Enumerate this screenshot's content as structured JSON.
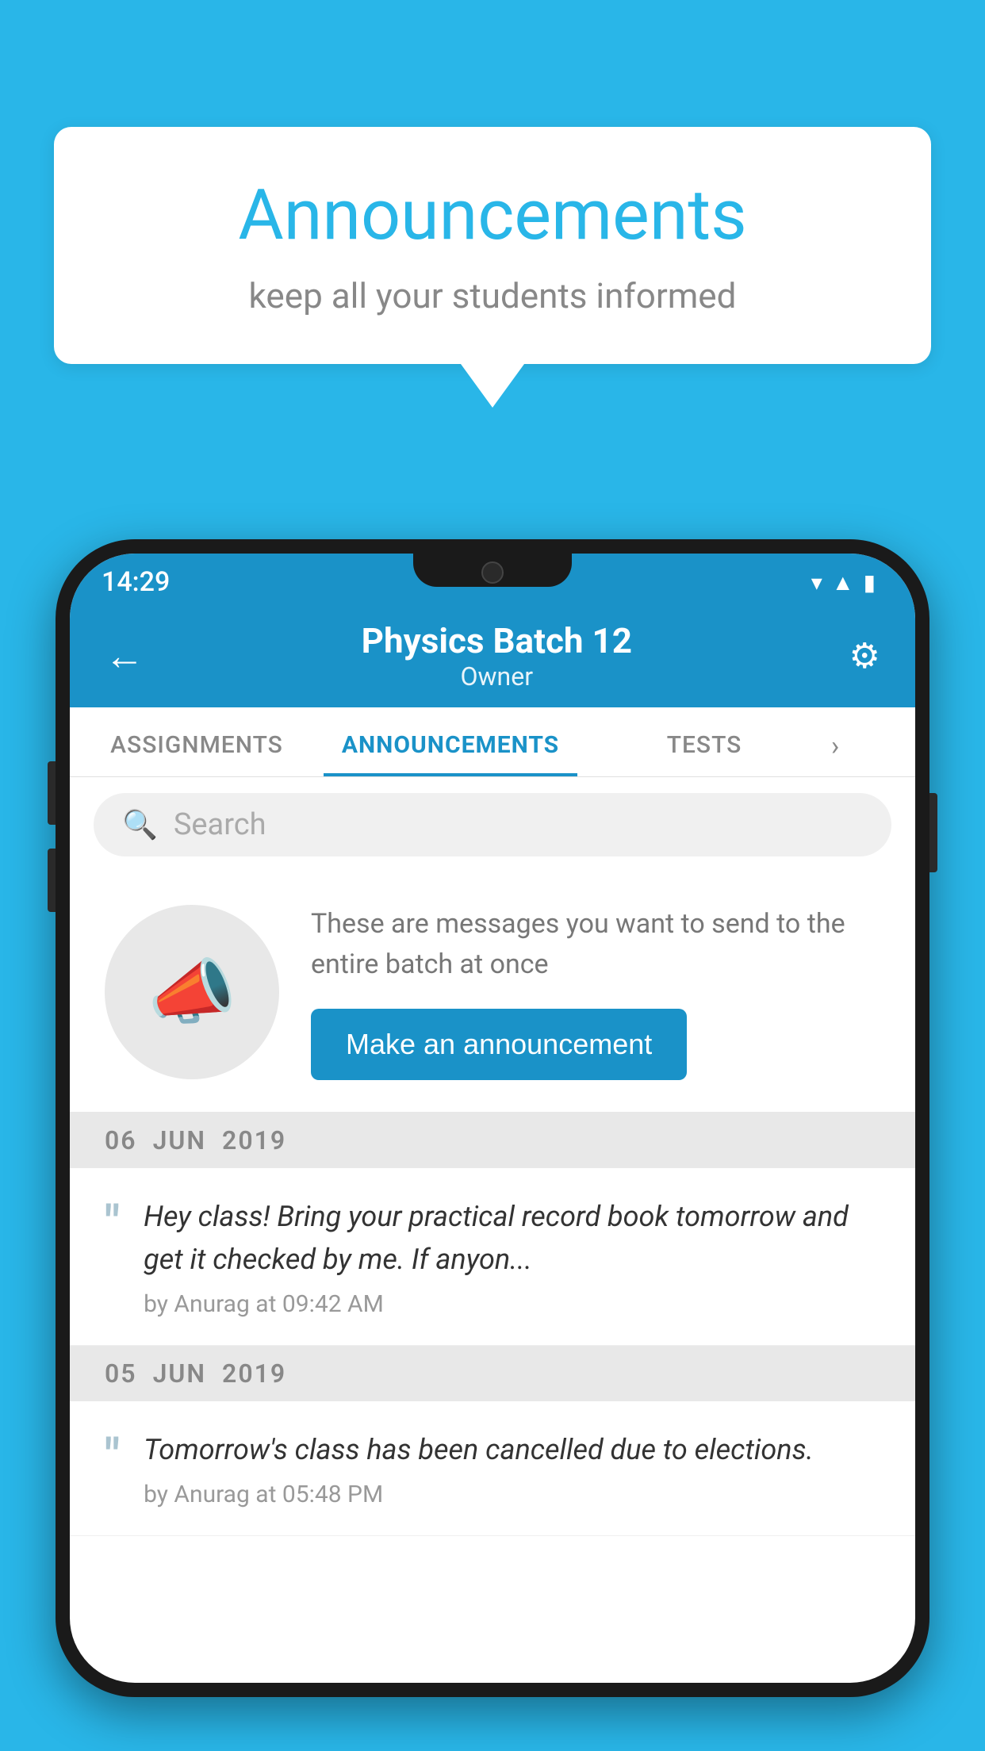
{
  "background_color": "#29b6e8",
  "speech_bubble": {
    "title": "Announcements",
    "subtitle": "keep all your students informed"
  },
  "phone": {
    "status_bar": {
      "time": "14:29",
      "icons": [
        "wifi",
        "signal",
        "battery"
      ]
    },
    "header": {
      "title": "Physics Batch 12",
      "subtitle": "Owner",
      "back_label": "←",
      "gear_label": "⚙"
    },
    "tabs": [
      {
        "label": "ASSIGNMENTS",
        "active": false
      },
      {
        "label": "ANNOUNCEMENTS",
        "active": true
      },
      {
        "label": "TESTS",
        "active": false
      }
    ],
    "search": {
      "placeholder": "Search"
    },
    "promo": {
      "text": "These are messages you want to send to the entire batch at once",
      "button_label": "Make an announcement"
    },
    "announcements": [
      {
        "date_day": "06",
        "date_month": "JUN",
        "date_year": "2019",
        "text": "Hey class! Bring your practical record book tomorrow and get it checked by me. If anyon...",
        "meta": "by Anurag at 09:42 AM"
      },
      {
        "date_day": "05",
        "date_month": "JUN",
        "date_year": "2019",
        "text": "Tomorrow's class has been cancelled due to elections.",
        "meta": "by Anurag at 05:48 PM"
      }
    ]
  }
}
